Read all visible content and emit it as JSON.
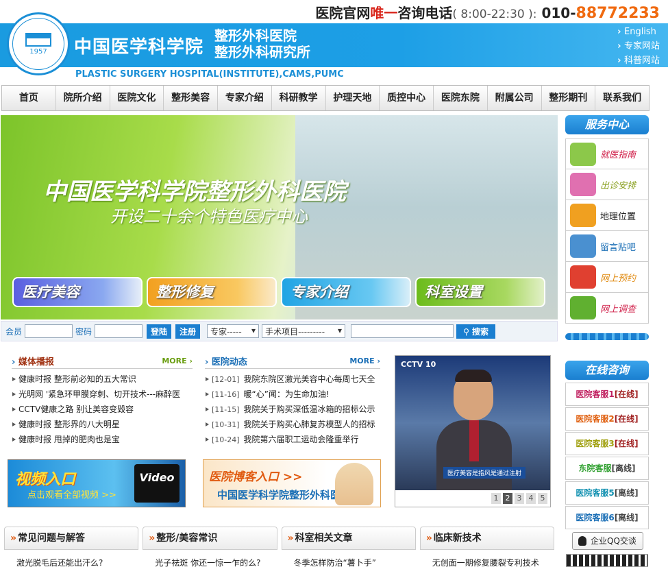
{
  "header": {
    "hotline_prefix": "医院官网",
    "hotline_red": "唯一",
    "hotline_mid": "咨询电话",
    "hotline_hours": "( 8:00-22:30 ):",
    "hotline_area": "010-",
    "hotline_number": "88772233",
    "logo_year": "1957",
    "cn_name": "中国医学科学院",
    "cn_sub1": "整形外科医院",
    "cn_sub2": "整形外科研究所",
    "en_name": "PLASTIC SURGERY HOSPITAL(INSTITUTE),CAMS,PUMC",
    "top_links": [
      "English",
      "专家网站",
      "科普网站"
    ]
  },
  "nav": [
    "首页",
    "院所介绍",
    "医院文化",
    "整形美容",
    "专家介绍",
    "科研教学",
    "护理天地",
    "质控中心",
    "医院东院",
    "附属公司",
    "整形期刊",
    "联系我们"
  ],
  "hero": {
    "title": "中国医学科学院整形外科医院",
    "subtitle": "开设二十余个特色医疗中心",
    "buttons": [
      "医疗美容",
      "整形修复",
      "专家介绍",
      "科室设置"
    ]
  },
  "login": {
    "member_label": "会员",
    "password_label": "密码",
    "login_btn": "登陆",
    "register_btn": "注册",
    "expert_select": "专家-----",
    "surgery_select": "手术项目---------",
    "search_btn": "搜索"
  },
  "service": {
    "title": "服务中心",
    "items": [
      {
        "label": "就医指南",
        "color": "#d0204a",
        "icon": "stethoscope-icon",
        "icon_color": "#8cc84a"
      },
      {
        "label": "出诊安排",
        "color": "#8aa020",
        "icon": "calendar-icon",
        "icon_color": "#e070b0"
      },
      {
        "label": "地理位置",
        "color": "#222222",
        "icon": "building-icon",
        "icon_color": "#f0a020"
      },
      {
        "label": "留言贴吧",
        "color": "#1b6fb6",
        "icon": "laptop-icon",
        "icon_color": "#4a90d0"
      },
      {
        "label": "网上预约",
        "color": "#e08a10",
        "icon": "people-icon",
        "icon_color": "#e04030"
      },
      {
        "label": "网上调查",
        "color": "#d0204a",
        "icon": "pencil-icon",
        "icon_color": "#60b030"
      }
    ]
  },
  "consult": {
    "title": "在线咨询",
    "items": [
      {
        "name": "医院客服1",
        "status": "[在线]",
        "color": "#c02060"
      },
      {
        "name": "医院客服2",
        "status": "[在线]",
        "color": "#e06010"
      },
      {
        "name": "医院客服3",
        "status": "[在线]",
        "color": "#a0a010"
      },
      {
        "name": "东院客服",
        "status": "[离线]",
        "color": "#30a030"
      },
      {
        "name": "医院客服5",
        "status": "[离线]",
        "color": "#1090b0"
      },
      {
        "name": "医院客服6",
        "status": "[离线]",
        "color": "#1b6fb6"
      }
    ],
    "qq_label": "企业QQ交谈"
  },
  "media": {
    "title": "媒体播报",
    "more": "MORE",
    "items": [
      "健康时报 整形前必知的五大常识",
      "光明网 '紧急环甲膜穿刺、切开技术---麻醉医",
      "CCTV健康之路 别让美容变毁容",
      "健康时报 整形界的八大明星",
      "健康时报 甩掉的肥肉也是宝"
    ]
  },
  "hospital_news": {
    "title": "医院动态",
    "more": "MORE",
    "items": [
      {
        "date": "[12-01]",
        "text": "我院东院区激光美容中心每周七天全"
      },
      {
        "date": "[11-16]",
        "text": "暖“心”闻：为生命加油!"
      },
      {
        "date": "[11-15]",
        "text": "我院关于购买深低温冰箱的招标公示"
      },
      {
        "date": "[10-31]",
        "text": "我院关于购买心肺复苏模型人的招标"
      },
      {
        "date": "[10-24]",
        "text": "我院第六届职工运动会隆重举行"
      }
    ]
  },
  "promo_video": {
    "line1": "视频入口",
    "line2": "点击观看全部视频 >>",
    "tv_text": "Video"
  },
  "promo_blog": {
    "line1": "医院博客入口 >>",
    "line2": "中国医学科学院整形外科医院"
  },
  "player": {
    "channel": "CCTV 10",
    "caption": "医疗美容是指风是通过注射",
    "pages": [
      "1",
      "2",
      "3",
      "4",
      "5"
    ],
    "active_page": "2"
  },
  "bottom_tabs": [
    "常见问题与解答",
    "整形/美容常识",
    "科室相关文章",
    "临床新技术"
  ],
  "bottom_news": [
    "激光脱毛后还能出汗么?",
    "光子祛斑 你还一惊一乍的么?",
    "冬季怎样防治“薯卜手”",
    "无创面一期修复腰裂专利技术"
  ]
}
